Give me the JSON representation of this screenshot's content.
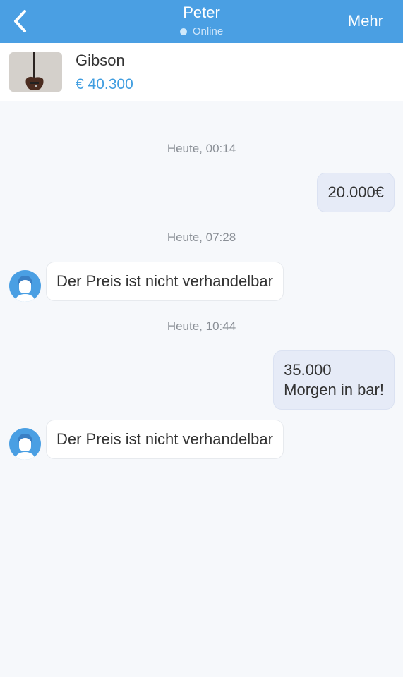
{
  "header": {
    "title": "Peter",
    "status": "Online",
    "more_label": "Mehr",
    "back_icon": "chevron-left-icon"
  },
  "product": {
    "name": "Gibson",
    "price": "€ 40.300"
  },
  "messages": [
    {
      "timestamp": "Heute, 00:14"
    },
    {
      "direction": "out",
      "text": "20.000€"
    },
    {
      "timestamp": "Heute, 07:28"
    },
    {
      "direction": "in",
      "text": "Der Preis ist nicht verhandelbar"
    },
    {
      "timestamp": "Heute, 10:44"
    },
    {
      "direction": "out",
      "lines": [
        "35.000",
        "Morgen in bar!"
      ]
    },
    {
      "direction": "in",
      "text": "Der Preis ist nicht verhandelbar"
    }
  ],
  "colors": {
    "header_bg": "#4a9fe3",
    "price_blue": "#3f9de0",
    "outgoing_bubble": "#e6ebf7",
    "incoming_bubble": "#ffffff",
    "background": "#f6f8fb"
  }
}
